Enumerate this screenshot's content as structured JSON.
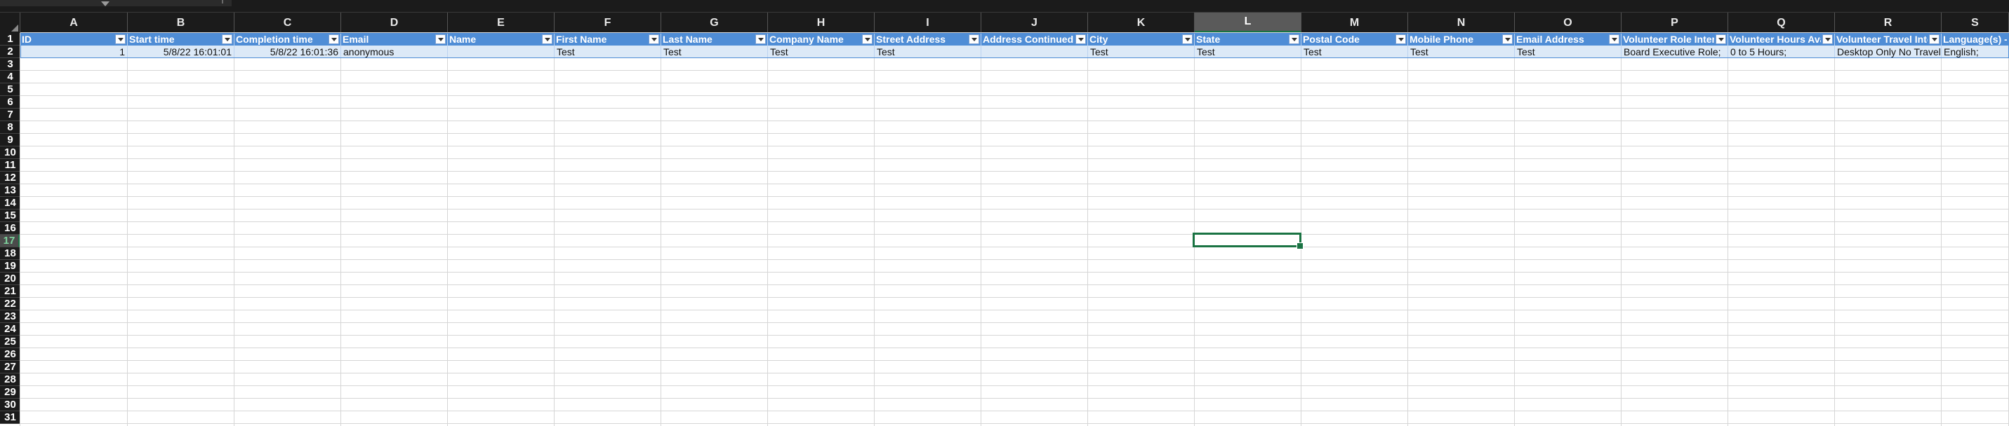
{
  "app": "Spreadsheet",
  "colors": {
    "header_fill": "#4f8dd6",
    "row_fill": "#dce9f7",
    "selection": "#1a7343"
  },
  "selected_cell": {
    "column": "L",
    "row": "17"
  },
  "columns": [
    "A",
    "B",
    "C",
    "D",
    "E",
    "F",
    "G",
    "H",
    "I",
    "J",
    "K",
    "L",
    "M",
    "N",
    "O",
    "P",
    "Q",
    "R",
    "S"
  ],
  "rows": [
    "1",
    "2",
    "3",
    "4",
    "5",
    "6",
    "7",
    "8",
    "9",
    "10",
    "11",
    "12",
    "13",
    "14",
    "15",
    "16",
    "17",
    "18",
    "19",
    "20",
    "21",
    "22",
    "23",
    "24",
    "25",
    "26",
    "27",
    "28",
    "29",
    "30",
    "31"
  ],
  "table": {
    "headers": [
      "ID",
      "Start time",
      "Completion time",
      "Email",
      "Name",
      "First Name",
      "Last Name",
      "Company Name",
      "Street Address",
      "Address Continued",
      "City",
      "State",
      "Postal Code",
      "Mobile Phone",
      "Email Address",
      "Volunteer Role Interest",
      "Volunteer Hours Available",
      "Volunteer Travel Interest",
      "Language(s) - Please"
    ],
    "row2": [
      "1",
      "5/8/22 16:01:01",
      "5/8/22 16:01:36",
      "anonymous",
      "",
      "Test",
      "Test",
      "Test",
      "Test",
      "",
      "Test",
      "Test",
      "Test",
      "Test",
      "Test",
      "Board Executive Role;",
      "0 to 5 Hours;",
      "Desktop Only No Travel",
      "English;"
    ]
  }
}
